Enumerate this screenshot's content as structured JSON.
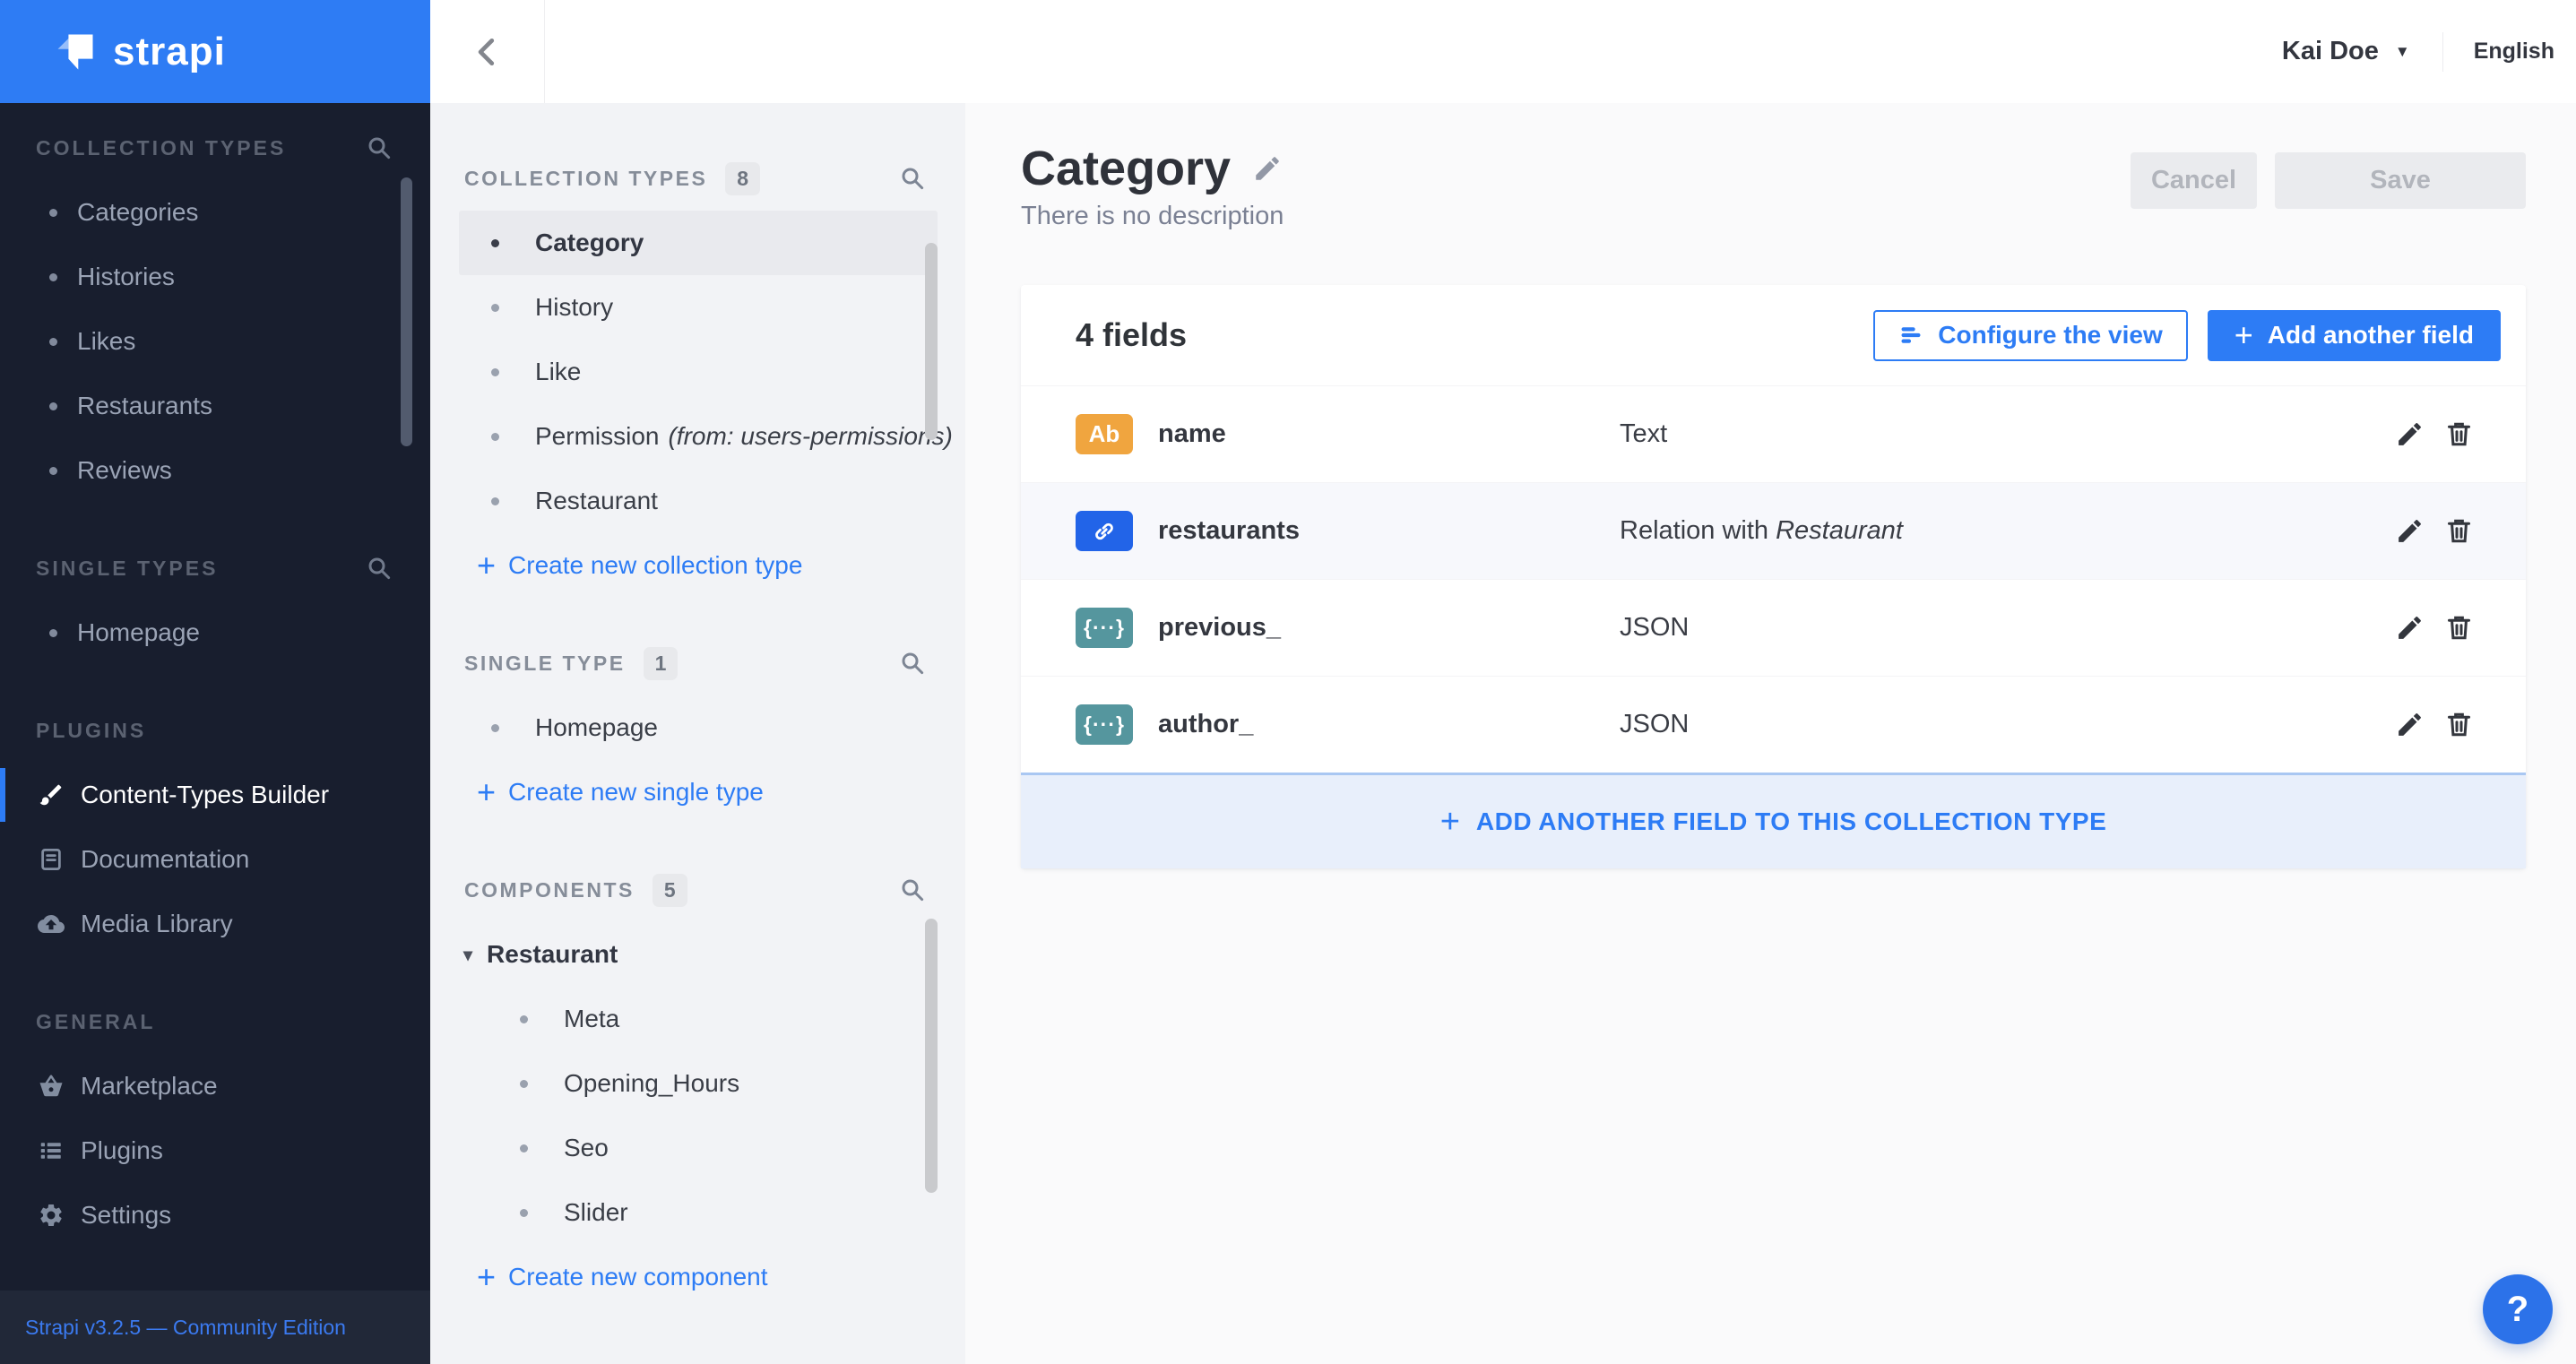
{
  "colors": {
    "accent": "#2d7cf5",
    "logo_bg": "#2e7cf4",
    "dark_sidebar": "#181e2e",
    "icon_text_field": "#f0a53f",
    "icon_relation_field": "#2264e8",
    "icon_json_field": "#55969e"
  },
  "brand": {
    "name": "strapi"
  },
  "glyphs": {
    "plus": "+",
    "caret_down": "▼",
    "tree_caret": "▾",
    "question": "?"
  },
  "topbar": {
    "user_name": "Kai Doe",
    "language": "English"
  },
  "sidebar": {
    "sections": [
      {
        "title": "COLLECTION TYPES",
        "items": [
          {
            "label": "Categories"
          },
          {
            "label": "Histories"
          },
          {
            "label": "Likes"
          },
          {
            "label": "Restaurants"
          },
          {
            "label": "Reviews"
          }
        ]
      },
      {
        "title": "SINGLE TYPES",
        "items": [
          {
            "label": "Homepage"
          }
        ]
      },
      {
        "title": "PLUGINS",
        "items": [
          {
            "label": "Content-Types Builder"
          },
          {
            "label": "Documentation"
          },
          {
            "label": "Media Library"
          }
        ]
      },
      {
        "title": "GENERAL",
        "items": [
          {
            "label": "Marketplace"
          },
          {
            "label": "Plugins"
          },
          {
            "label": "Settings"
          }
        ]
      }
    ],
    "footer_link": "Strapi v3.2.5 — Community Edition"
  },
  "schema_nav": {
    "collection": {
      "title": "COLLECTION TYPES",
      "count": "8",
      "items": [
        {
          "label": "Category"
        },
        {
          "label": "History"
        },
        {
          "label": "Like"
        },
        {
          "label": "Permission",
          "note": "(from: users-permissions)"
        },
        {
          "label": "Restaurant"
        }
      ],
      "action": "Create new collection type"
    },
    "single": {
      "title": "SINGLE TYPE",
      "count": "1",
      "items": [
        {
          "label": "Homepage"
        }
      ],
      "action": "Create new single type"
    },
    "components": {
      "title": "COMPONENTS",
      "count": "5",
      "parent": "Restaurant",
      "children": [
        {
          "label": "Meta"
        },
        {
          "label": "Opening_Hours"
        },
        {
          "label": "Seo"
        },
        {
          "label": "Slider"
        }
      ],
      "action": "Create new component"
    }
  },
  "main": {
    "title": "Category",
    "description": "There is no description",
    "cancel_label": "Cancel",
    "save_label": "Save",
    "panel": {
      "count_label": "4 fields",
      "configure_label": "Configure the view",
      "add_field_label": "Add another field",
      "rows": [
        {
          "badge": "Ab",
          "name": "name",
          "type": "Text"
        },
        {
          "name": "restaurants",
          "type_prefix": "Relation with ",
          "type_target": "Restaurant"
        },
        {
          "badge": "{···}",
          "name": "previous_",
          "type": "JSON"
        },
        {
          "badge": "{···}",
          "name": "author_",
          "type": "JSON"
        }
      ],
      "add_another_label": "ADD ANOTHER FIELD TO THIS COLLECTION TYPE"
    }
  }
}
